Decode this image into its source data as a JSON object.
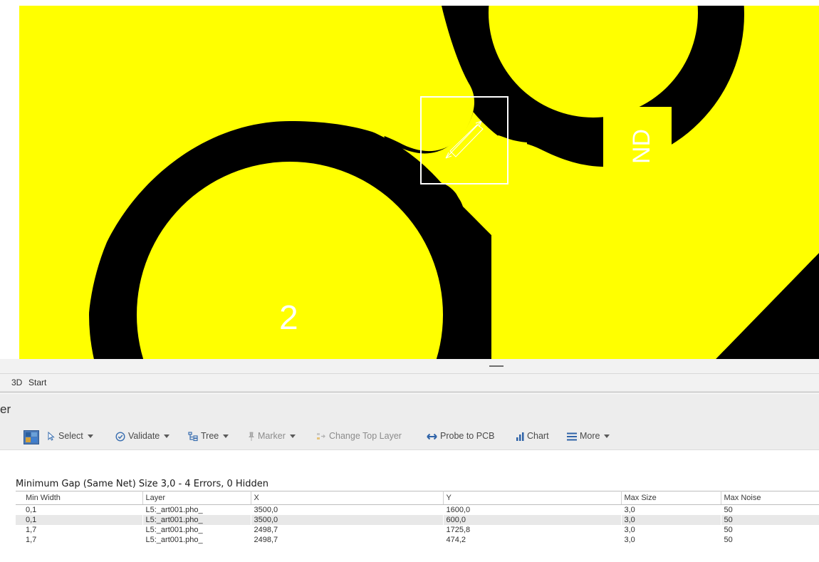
{
  "pcb": {
    "colors": {
      "copper": "#ffff00",
      "gap": "#000000",
      "marker": "#ffffff"
    },
    "pad_labels": {
      "pad_2": "2",
      "pad_nd": "ND"
    }
  },
  "menu": {
    "tabs": [
      {
        "label": "3D"
      },
      {
        "label": "Start"
      }
    ]
  },
  "panel": {
    "title": "er"
  },
  "toolbar": {
    "select_label": "Select",
    "validate_label": "Validate",
    "tree_label": "Tree",
    "marker_label": "Marker",
    "change_top_layer_label": "Change Top Layer",
    "probe_label": "Probe to PCB",
    "chart_label": "Chart",
    "more_label": "More",
    "icons": [
      "layer-display-icon",
      "cursor-icon",
      "check-circle-icon",
      "tree-icon",
      "marker-pin-icon",
      "change-layer-icon",
      "probe-arrows-icon",
      "chart-bars-icon",
      "hamburger-icon"
    ]
  },
  "results": {
    "title": "Minimum Gap (Same Net) Size 3,0 - 4 Errors, 0 Hidden",
    "columns": [
      "Min Width",
      "Layer",
      "X",
      "Y",
      "Max Size",
      "Max Noise"
    ],
    "rows": [
      [
        "0,1",
        "L5:_art001.pho_",
        "3500,0",
        "1600,0",
        "3,0",
        "50"
      ],
      [
        "0,1",
        "L5:_art001.pho_",
        "3500,0",
        "600,0",
        "3,0",
        "50"
      ],
      [
        "1,7",
        "L5:_art001.pho_",
        "2498,7",
        "1725,8",
        "3,0",
        "50"
      ],
      [
        "1,7",
        "L5:_art001.pho_",
        "2498,7",
        "474,2",
        "3,0",
        "50"
      ]
    ]
  }
}
